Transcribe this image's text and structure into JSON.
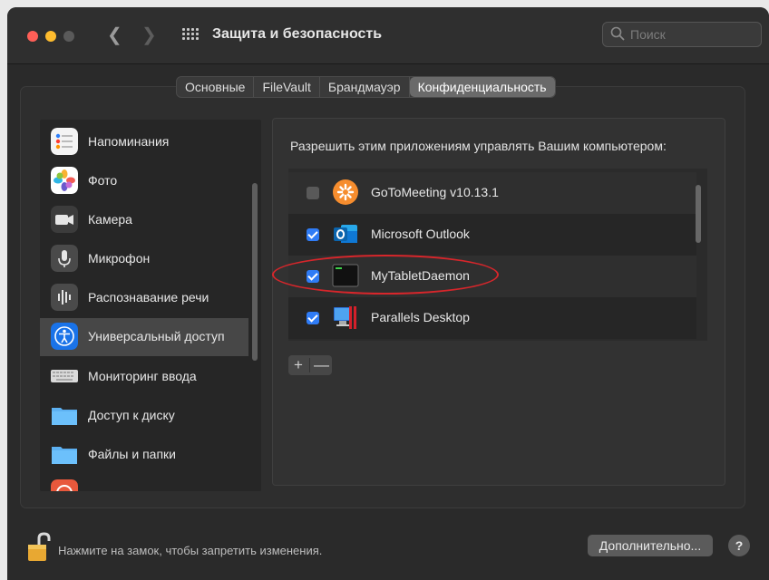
{
  "window": {
    "title": "Защита и безопасность",
    "search_placeholder": "Поиск"
  },
  "tabs": [
    {
      "label": "Основные",
      "active": false
    },
    {
      "label": "FileVault",
      "active": false
    },
    {
      "label": "Брандмауэр",
      "active": false
    },
    {
      "label": "Конфиденциальность",
      "active": true
    }
  ],
  "sidebar": {
    "items": [
      {
        "label": "Напоминания",
        "icon": "reminders-icon",
        "selected": false
      },
      {
        "label": "Фото",
        "icon": "photos-icon",
        "selected": false
      },
      {
        "label": "Камера",
        "icon": "camera-icon",
        "selected": false
      },
      {
        "label": "Микрофон",
        "icon": "microphone-icon",
        "selected": false
      },
      {
        "label": "Распознавание речи",
        "icon": "speech-recognition-icon",
        "selected": false
      },
      {
        "label": "Универсальный доступ",
        "icon": "accessibility-icon",
        "selected": true
      },
      {
        "label": "Мониторинг ввода",
        "icon": "keyboard-icon",
        "selected": false
      },
      {
        "label": "Доступ к диску",
        "icon": "folder-icon",
        "selected": false
      },
      {
        "label": "Файлы и папки",
        "icon": "folder-icon",
        "selected": false
      }
    ]
  },
  "main": {
    "heading": "Разрешить этим приложениям управлять Вашим компьютером:",
    "apps": [
      {
        "name": "GoToMeeting v10.13.1",
        "checked": false,
        "icon": "gotomeeting-icon"
      },
      {
        "name": "Microsoft Outlook",
        "checked": true,
        "icon": "outlook-icon"
      },
      {
        "name": "MyTabletDaemon",
        "checked": true,
        "icon": "terminal-icon"
      },
      {
        "name": "Parallels Desktop",
        "checked": true,
        "icon": "parallels-icon"
      }
    ],
    "add_label": "+",
    "remove_label": "—"
  },
  "footer": {
    "lock_text": "Нажмите на замок, чтобы запретить изменения.",
    "advanced_label": "Дополнительно...",
    "help_label": "?"
  },
  "colors": {
    "checkbox_on": "#2f7cf6",
    "selection": "#474747",
    "highlight_ellipse": "#d7262b"
  }
}
